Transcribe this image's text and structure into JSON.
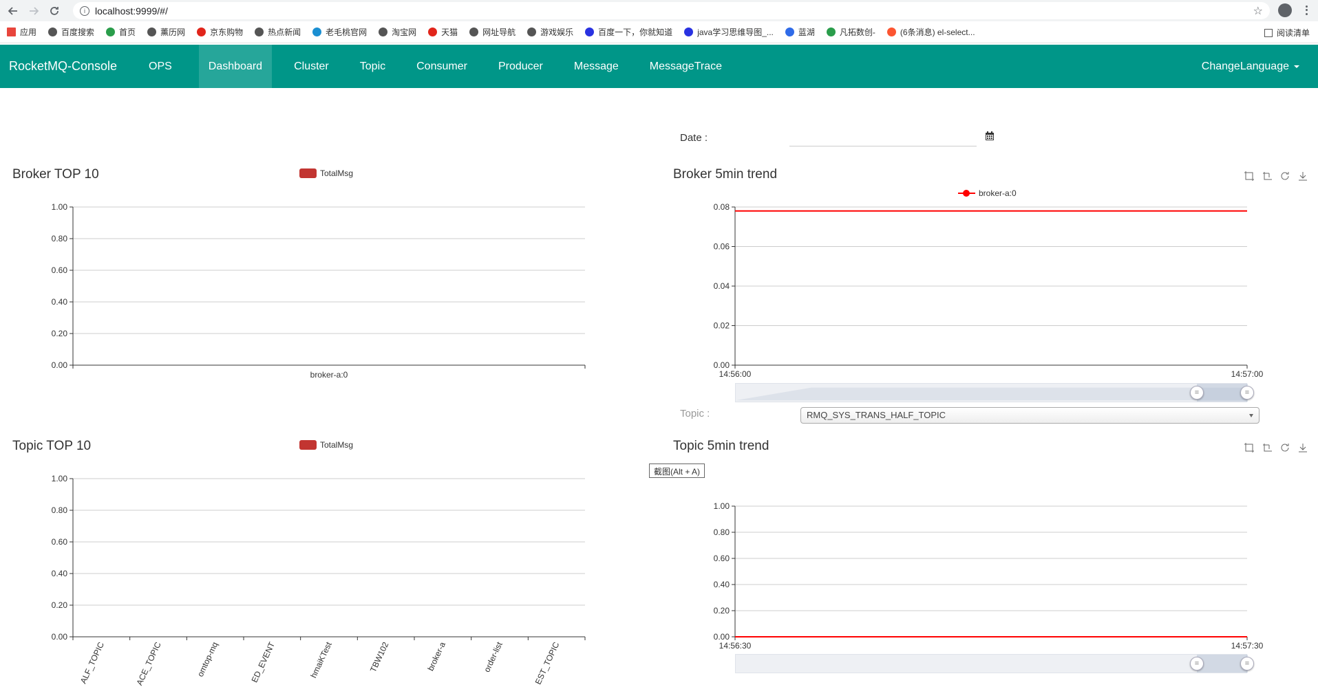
{
  "browser": {
    "url": "localhost:9999/#/",
    "bookmarks": [
      {
        "label": "应用",
        "icon": "apps-grid-icon",
        "color": "#e8453c"
      },
      {
        "label": "百度搜索",
        "icon": "globe-icon",
        "color": "#555555"
      },
      {
        "label": "首页",
        "icon": "leaf-icon",
        "color": "#2a9d4b"
      },
      {
        "label": "薰历网",
        "icon": "globe-icon",
        "color": "#555555"
      },
      {
        "label": "京东购物",
        "icon": "jd-icon",
        "color": "#e1251b"
      },
      {
        "label": "热点新闻",
        "icon": "globe-icon",
        "color": "#555555"
      },
      {
        "label": "老毛桃官网",
        "icon": "peach-icon",
        "color": "#1b8fd2"
      },
      {
        "label": "淘宝网",
        "icon": "globe-icon",
        "color": "#555555"
      },
      {
        "label": "天猫",
        "icon": "tmall-icon",
        "color": "#e1251b"
      },
      {
        "label": "网址导航",
        "icon": "globe-icon",
        "color": "#555555"
      },
      {
        "label": "游戏娱乐",
        "icon": "globe-icon",
        "color": "#555555"
      },
      {
        "label": "百度一下，你就知道",
        "icon": "baidu-paw-icon",
        "color": "#2932e1"
      },
      {
        "label": "java学习思维导图_...",
        "icon": "baidu-paw-icon",
        "color": "#2932e1"
      },
      {
        "label": "蓝湖",
        "icon": "lanhu-icon",
        "color": "#2f6be8"
      },
      {
        "label": "凡拓数创-",
        "icon": "gear-icon",
        "color": "#2a9d4b"
      },
      {
        "label": "(6条消息) el-select...",
        "icon": "csdn-icon",
        "color": "#fc5531"
      }
    ],
    "reading_list": "阅读清单"
  },
  "navbar": {
    "brand": "RocketMQ-Console",
    "ops": "OPS",
    "items": [
      "Dashboard",
      "Cluster",
      "Topic",
      "Consumer",
      "Producer",
      "Message",
      "MessageTrace"
    ],
    "active": "Dashboard",
    "change_language": "ChangeLanguage",
    "color": "#009688"
  },
  "date_picker": {
    "label": "Date :",
    "value": ""
  },
  "broker_top10": {
    "title": "Broker TOP 10",
    "legend": "TotalMsg"
  },
  "broker_trend": {
    "title": "Broker 5min trend",
    "legend": "broker-a:0"
  },
  "topic_selector": {
    "label": "Topic :",
    "selected": "RMQ_SYS_TRANS_HALF_TOPIC"
  },
  "topic_top10": {
    "title": "Topic TOP 10",
    "legend": "TotalMsg"
  },
  "topic_trend": {
    "title": "Topic 5min trend"
  },
  "screenshot_tooltip": "截图(Alt + A)",
  "chart_data": [
    {
      "type": "bar",
      "title": "Broker TOP 10",
      "categories": [
        "broker-a:0"
      ],
      "series": [
        {
          "name": "TotalMsg",
          "values": [
            0
          ],
          "color": "#c23531"
        }
      ],
      "ylim": [
        0,
        1
      ],
      "yticks": [
        "0.00",
        "0.20",
        "0.40",
        "0.60",
        "0.80",
        "1.00"
      ],
      "grid": true,
      "legend": "top-center"
    },
    {
      "type": "line",
      "title": "Broker 5min trend",
      "x": [
        "14:56:00",
        "14:57:00"
      ],
      "series": [
        {
          "name": "broker-a:0",
          "values": [
            0.078,
            0.078
          ],
          "color": "#ff0000"
        }
      ],
      "ylim": [
        0,
        0.08
      ],
      "yticks": [
        "0.00",
        "0.02",
        "0.04",
        "0.06",
        "0.08"
      ],
      "grid": true,
      "legend": "top-center",
      "datazoom": {
        "start": 0.9,
        "end": 1.0
      }
    },
    {
      "type": "bar",
      "title": "Topic TOP 10",
      "categories": [
        "ALF_TOPIC",
        "ACE_TOPIC",
        "omtop-mq",
        "ED_EVENT",
        "hmaiKTest",
        "TBW102",
        "broker-a",
        "order-list",
        "EST_TOPIC"
      ],
      "series": [
        {
          "name": "TotalMsg",
          "values": [
            0,
            0,
            0,
            0,
            0,
            0,
            0,
            0,
            0
          ],
          "color": "#c23531"
        }
      ],
      "ylim": [
        0,
        1
      ],
      "yticks": [
        "0.00",
        "0.20",
        "0.40",
        "0.60",
        "0.80",
        "1.00"
      ],
      "grid": true,
      "legend": "top-center"
    },
    {
      "type": "line",
      "title": "Topic 5min trend",
      "x": [
        "14:56:30",
        "14:57:30"
      ],
      "series": [
        {
          "values": [
            0,
            0
          ],
          "color": "#ff0000"
        }
      ],
      "ylim": [
        0,
        1
      ],
      "yticks": [
        "0.00",
        "0.20",
        "0.40",
        "0.60",
        "0.80",
        "1.00"
      ],
      "grid": true,
      "datazoom": {
        "start": 0.9,
        "end": 1.0
      }
    }
  ]
}
